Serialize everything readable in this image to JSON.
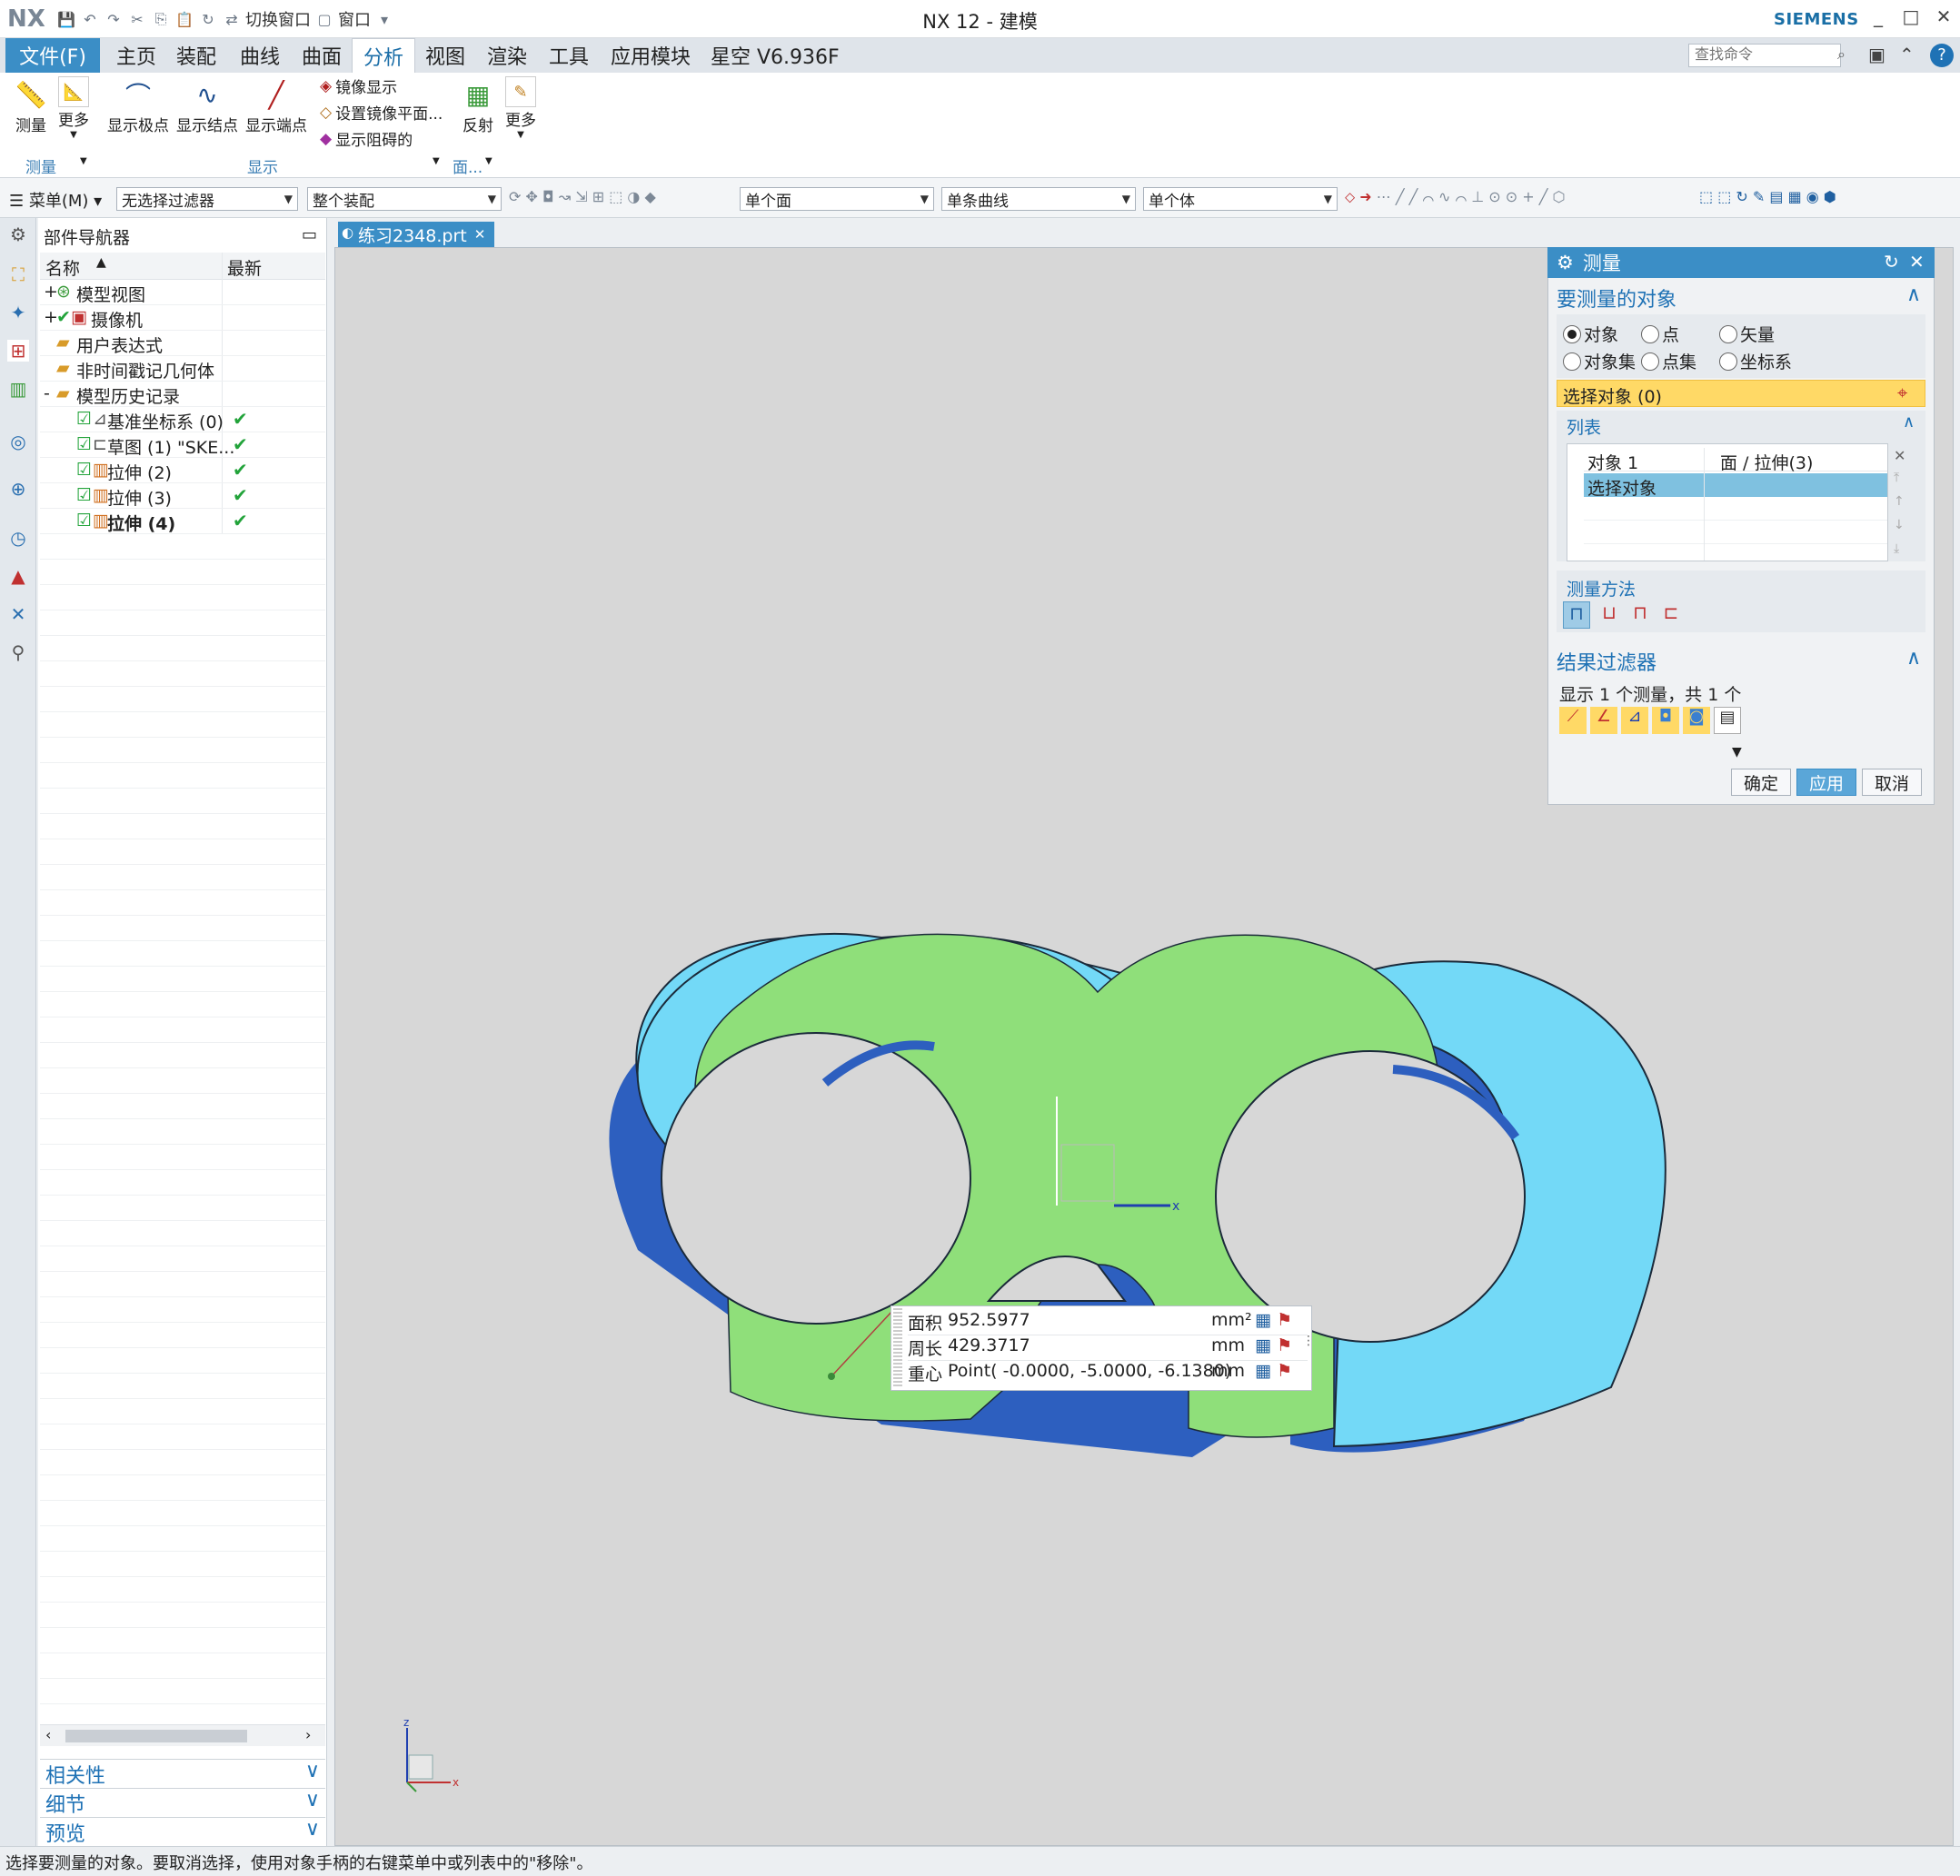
{
  "app": {
    "logo": "NX",
    "title": "NX 12 - 建模",
    "brand": "SIEMENS"
  },
  "quick_access": {
    "switch_window": "切换窗口",
    "window": "窗口"
  },
  "tabs": {
    "file": "文件(F)",
    "items": [
      "主页",
      "装配",
      "曲线",
      "曲面",
      "分析",
      "视图",
      "渲染",
      "工具",
      "应用模块",
      "星空 V6.936F"
    ],
    "active": "分析"
  },
  "search": {
    "placeholder": "查找命令"
  },
  "ribbon": {
    "measure": "测量",
    "more1": "更多",
    "show_pole": "显示极点",
    "show_knot": "显示结点",
    "show_endpoint": "显示端点",
    "mirror_display": "镜像显示",
    "set_mirror_plane": "设置镜像平面...",
    "show_blocking": "显示阻碍的",
    "reflect": "反射",
    "more2": "更多",
    "group_measure": "测量",
    "group_display": "显示",
    "group_face": "面..."
  },
  "selection_bar": {
    "menu": "菜单(M)",
    "filter": "无选择过滤器",
    "scope": "整个装配",
    "face_rule": "单个面",
    "curve_rule": "单条曲线",
    "body_rule": "单个体"
  },
  "navigator": {
    "title": "部件导航器",
    "col_name": "名称",
    "col_latest": "最新",
    "items": [
      {
        "name": "模型视图",
        "expand": "+",
        "check": ""
      },
      {
        "name": "摄像机",
        "expand": "+",
        "check": ""
      },
      {
        "name": "用户表达式",
        "expand": "",
        "check": ""
      },
      {
        "name": "非时间戳记几何体",
        "expand": "",
        "check": ""
      },
      {
        "name": "模型历史记录",
        "expand": "-",
        "check": ""
      },
      {
        "name": "基准坐标系 (0)",
        "expand": "",
        "check": "✔"
      },
      {
        "name": "草图 (1) \"SKE...",
        "expand": "",
        "check": "✔"
      },
      {
        "name": "拉伸 (2)",
        "expand": "",
        "check": "✔"
      },
      {
        "name": "拉伸 (3)",
        "expand": "",
        "check": "✔"
      },
      {
        "name": "拉伸 (4)",
        "expand": "",
        "check": "✔"
      }
    ],
    "footer": [
      "相关性",
      "细节",
      "预览"
    ]
  },
  "graphics": {
    "tab": "练习2348.prt"
  },
  "measure_dialog": {
    "title": "测量",
    "section_objects": "要测量的对象",
    "radios": [
      "对象",
      "点",
      "矢量",
      "对象集",
      "点集",
      "坐标系"
    ],
    "selected_radio": "对象",
    "select_object": "选择对象 (0)",
    "list_label": "列表",
    "list_rows": [
      {
        "col1": "对象 1",
        "col2": "面 / 拉伸(3)"
      },
      {
        "col1": "选择对象",
        "col2": ""
      }
    ],
    "method_label": "测量方法",
    "section_filter": "结果过滤器",
    "summary": "显示 1 个测量，共 1 个",
    "ok": "确定",
    "apply": "应用",
    "cancel": "取消"
  },
  "measurement": {
    "rows": [
      {
        "label": "面积",
        "value": "952.5977",
        "unit": "mm²"
      },
      {
        "label": "周长",
        "value": "429.3717",
        "unit": "mm"
      },
      {
        "label": "重心",
        "value": "Point( -0.0000, -5.0000, -6.1380)",
        "unit": "mm"
      }
    ]
  },
  "status": {
    "text": "选择要测量的对象。要取消选择，使用对象手柄的右键菜单中或列表中的\"移除\"。"
  },
  "colors": {
    "accent": "#3b8ec6",
    "face_highlight": "#8fdf7a",
    "part_body": "#6fd8f5",
    "selection": "#ffd966"
  },
  "icons": [
    "save-icon",
    "undo-icon",
    "redo-icon",
    "ruler-icon",
    "gear-icon",
    "close-icon",
    "refresh-icon",
    "search-icon",
    "help-icon",
    "chevron-up-icon",
    "chevron-down-icon"
  ]
}
